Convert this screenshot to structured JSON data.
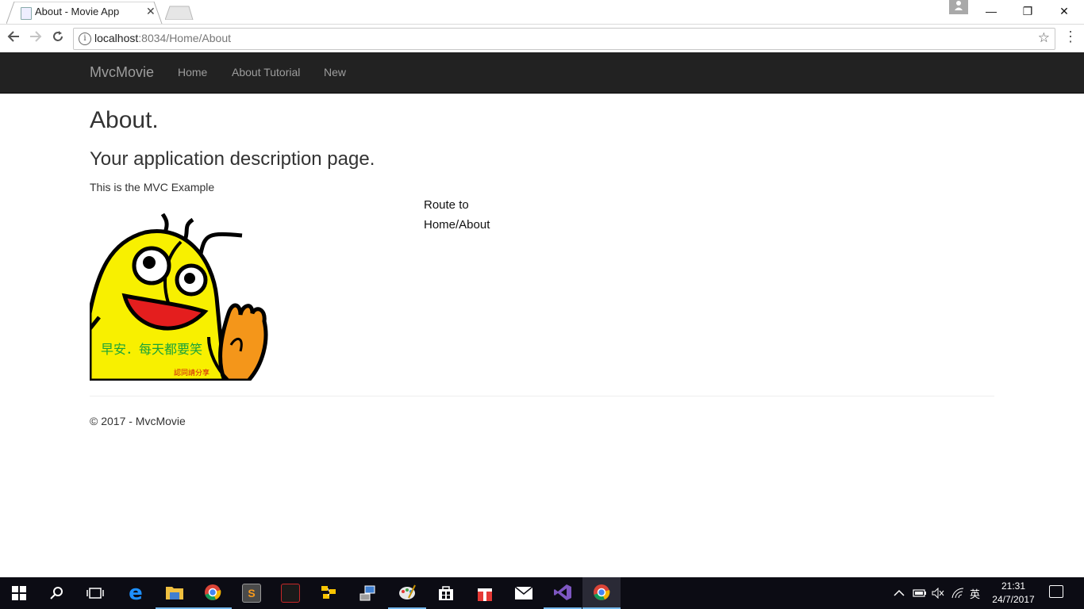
{
  "browser": {
    "tab_title": "About - Movie App",
    "tab_close": "✕",
    "profile_icon": "person-icon",
    "url_host": "localhost",
    "url_rest": ":8034/Home/About",
    "window_min": "—",
    "window_max": "❐",
    "window_close": "✕"
  },
  "navbar": {
    "brand": "MvcMovie",
    "links": [
      "Home",
      "About Tutorial",
      "New"
    ]
  },
  "page": {
    "title": "About.",
    "subtitle": "Your application description page.",
    "text": "This is the MVC Example",
    "route_line1": "Route to",
    "route_line2": "Home/About",
    "image_caption": "早安．每天都要笑",
    "image_small_caption": "認同請分享"
  },
  "footer": {
    "text": "© 2017 - MvcMovie"
  },
  "taskbar": {
    "items": [
      {
        "name": "start-icon",
        "color": "#ffffff"
      },
      {
        "name": "search-icon",
        "color": "#ffffff"
      },
      {
        "name": "task-view-icon",
        "color": "#ffffff"
      },
      {
        "name": "edge-icon",
        "color": "#1e90ff"
      },
      {
        "name": "file-explorer-icon",
        "color": "#f0c040"
      },
      {
        "name": "chrome-icon",
        "color": "#4caf50"
      },
      {
        "name": "sublime-icon",
        "color": "#555555"
      },
      {
        "name": "acrobat-icon",
        "color": "#c62828"
      },
      {
        "name": "tortoise-icon",
        "color": "#f9c400"
      },
      {
        "name": "network-tool-icon",
        "color": "#3f7fd0"
      },
      {
        "name": "paint-icon",
        "color": "#66aadd"
      },
      {
        "name": "store-icon",
        "color": "#ffffff"
      },
      {
        "name": "gift-icon",
        "color": "#e53935"
      },
      {
        "name": "mail-icon",
        "color": "#ffffff"
      },
      {
        "name": "visual-studio-icon",
        "color": "#7e57c2"
      },
      {
        "name": "chrome-active-icon",
        "color": "#4caf50"
      }
    ],
    "ime": "英",
    "time": "21:31",
    "date": "24/7/2017"
  }
}
